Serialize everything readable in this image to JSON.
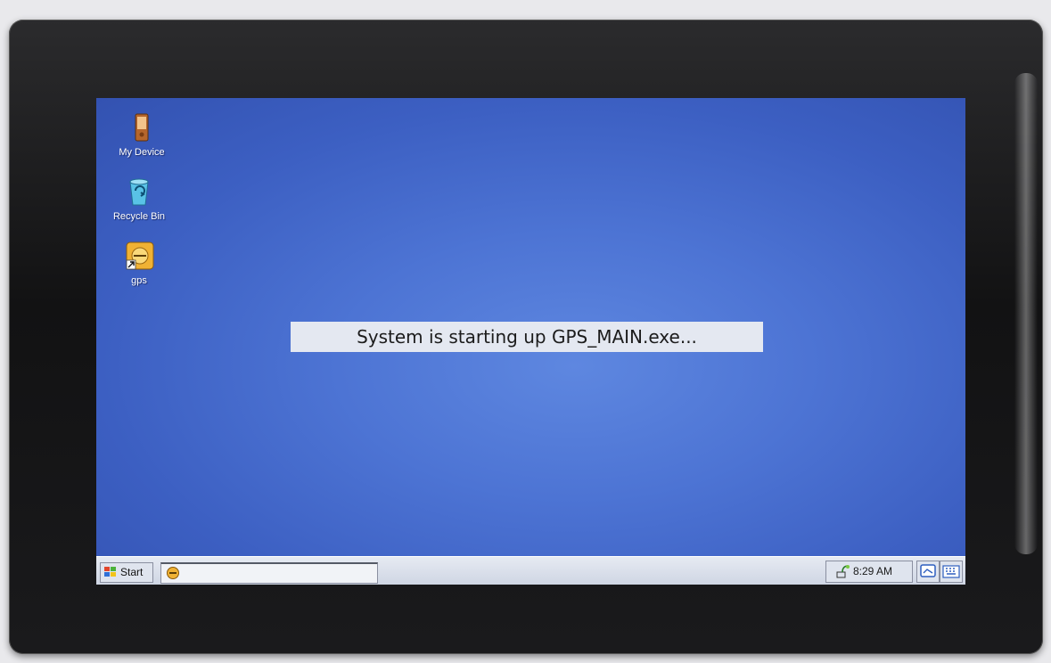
{
  "desktop": {
    "icons": [
      {
        "label": "My Device",
        "icon": "pda-device-icon"
      },
      {
        "label": "Recycle Bin",
        "icon": "recycle-bin-icon"
      },
      {
        "label": "gps",
        "icon": "gps-shortcut-icon"
      }
    ],
    "boot_message": "System is starting up GPS_MAIN.exe...",
    "wallpaper_color": "#4d74d4"
  },
  "taskbar": {
    "start_label": "Start",
    "running_app_icon": "gps-app-icon",
    "clock": "8:29 AM",
    "tray_icons": [
      "network-icon",
      "desktop-icon",
      "keyboard-icon"
    ]
  }
}
